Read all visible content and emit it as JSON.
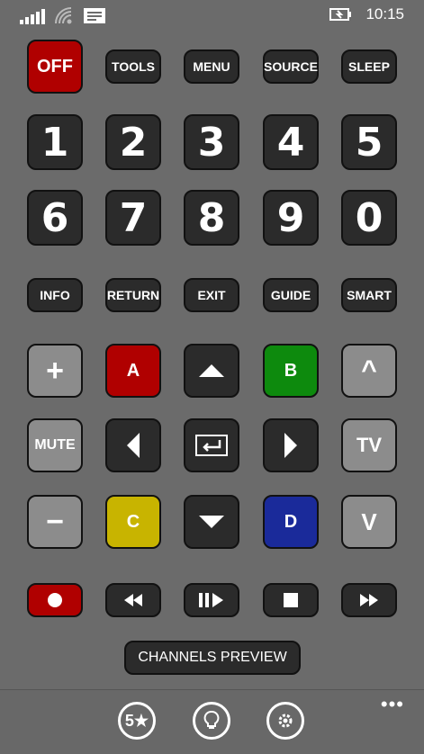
{
  "status": {
    "time": "10:15"
  },
  "top_row": {
    "off": "OFF",
    "tools": "TOOLS",
    "menu": "MENU",
    "source": "SOURCE",
    "sleep": "SLEEP"
  },
  "digits": [
    "1",
    "2",
    "3",
    "4",
    "5",
    "6",
    "7",
    "8",
    "9",
    "0"
  ],
  "func_row": {
    "info": "INFO",
    "return": "RETURN",
    "exit": "EXIT",
    "guide": "GUIDE",
    "smart": "SMART"
  },
  "color_keys": {
    "a": "A",
    "b": "B",
    "c": "C",
    "d": "D"
  },
  "side_keys": {
    "mute": "MUTE",
    "tv": "TV",
    "vol_up": "+",
    "vol_down": "−",
    "ch_up": "^",
    "ch_down": "V"
  },
  "channels_preview": "CHANNELS PREVIEW",
  "app_bar": {
    "rate": "5★",
    "more": "•••"
  },
  "colors": {
    "background": "#6b6b6b",
    "red": "#b00000",
    "green": "#0d8a0d",
    "yellow": "#c8b400",
    "blue": "#1a2a9a"
  }
}
